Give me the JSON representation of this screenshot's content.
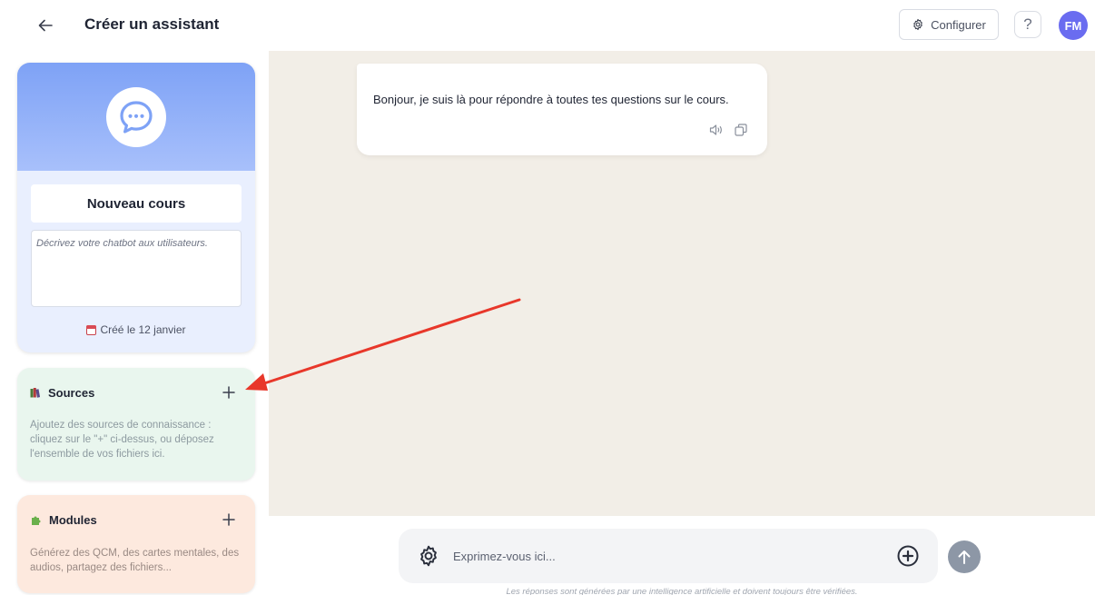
{
  "header": {
    "title": "Créer un assistant",
    "configure_label": "Configurer",
    "help_label": "?",
    "avatar_initials": "FM"
  },
  "colors": {
    "accent": "#6a6cf0",
    "banner": "#7ea2f6",
    "chat_bg": "#f2eee7",
    "annotation_arrow": "#e8372a"
  },
  "course": {
    "name": "Nouveau cours",
    "description_placeholder": "Décrivez votre chatbot aux utilisateurs.",
    "created": "Créé le 12 janvier"
  },
  "sources": {
    "title": "Sources",
    "add_label": "+",
    "help_text": "Ajoutez des sources de connaissance : cliquez sur le \"+\" ci-dessus, ou déposez l'ensemble de vos fichiers ici."
  },
  "modules": {
    "title": "Modules",
    "add_label": "+",
    "help_text": "Générez des QCM, des cartes mentales, des audios, partagez des fichiers..."
  },
  "chat": {
    "messages": [
      {
        "role": "assistant",
        "text": "Bonjour, je suis là pour répondre à toutes tes questions sur le cours."
      }
    ]
  },
  "composer": {
    "placeholder": "Exprimez-vous ici...",
    "disclaimer": "Les réponses sont générées par une intelligence artificielle et doivent toujours être vérifiées."
  },
  "icons": [
    "back-arrow-icon",
    "gear-icon",
    "help-icon",
    "chat-bubble-icon",
    "calendar-icon",
    "books-icon",
    "puzzle-icon",
    "plus-icon",
    "speaker-icon",
    "copy-icon",
    "add-circle-icon",
    "send-arrow-icon"
  ]
}
